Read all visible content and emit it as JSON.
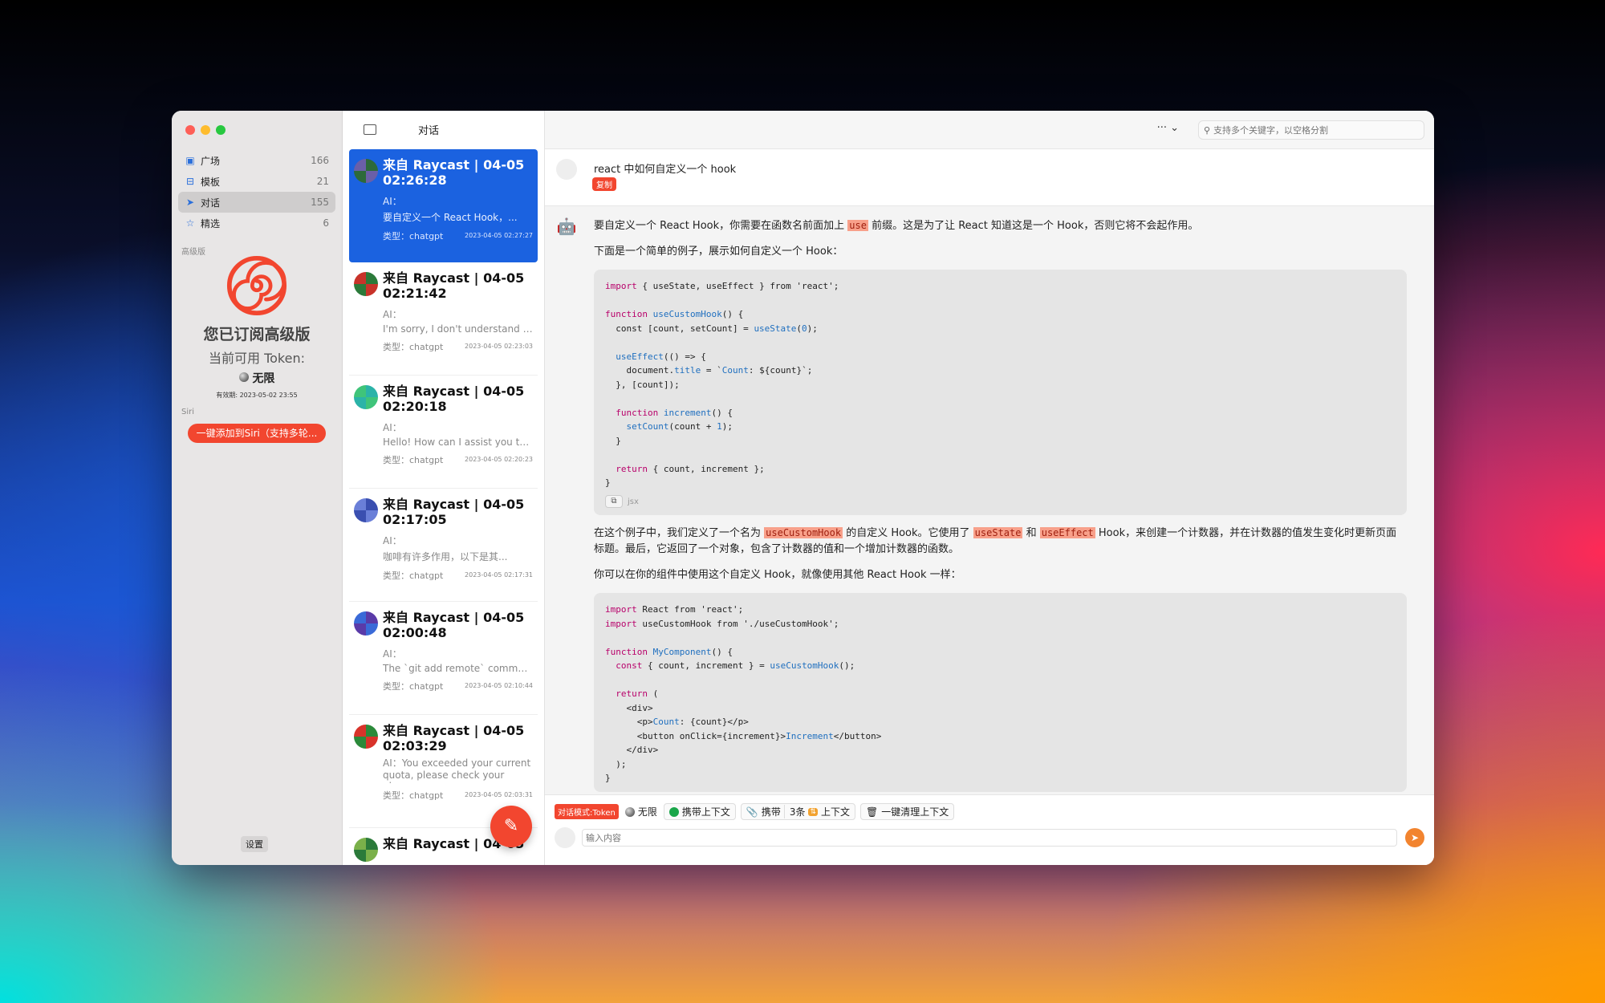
{
  "sidebar": {
    "items": [
      {
        "label": "广场",
        "count": "166"
      },
      {
        "label": "模板",
        "count": "21"
      },
      {
        "label": "对话",
        "count": "155"
      },
      {
        "label": "精选",
        "count": "6"
      }
    ],
    "premium_section": "高级版",
    "premium_title": "您已订阅高级版",
    "premium_token_label": "当前可用 Token:",
    "premium_token_value": "无限",
    "premium_expiry": "有效期: 2023-05-02 23:55",
    "siri_section": "Siri",
    "siri_button": "一键添加到Siri（支持多轮...",
    "settings_button": "设置"
  },
  "conversations": [
    {
      "title": "来自 Raycast | 04-05 02:26:28",
      "ai_label": "AI：",
      "preview": "要自定义一个 React Hook，...",
      "type_label": "类型：",
      "type": "chatgpt",
      "datetime": "2023-04-05 02:27:27"
    },
    {
      "title": "来自 Raycast | 04-05 02:21:42",
      "ai_label": "AI：",
      "preview": "I'm sorry, I don't understand w...",
      "type_label": "类型：",
      "type": "chatgpt",
      "datetime": "2023-04-05 02:23:03"
    },
    {
      "title": "来自 Raycast | 04-05 02:20:18",
      "ai_label": "AI：",
      "preview": "Hello! How can I assist you to...",
      "type_label": "类型：",
      "type": "chatgpt",
      "datetime": "2023-04-05 02:20:23"
    },
    {
      "title": "来自 Raycast | 04-05 02:17:05",
      "ai_label": "AI：",
      "preview": "咖啡有许多作用，以下是其...",
      "type_label": "类型：",
      "type": "chatgpt",
      "datetime": "2023-04-05 02:17:31"
    },
    {
      "title": "来自 Raycast | 04-05 02:00:48",
      "ai_label": "AI：",
      "preview": "The `git add remote` comma...",
      "type_label": "类型：",
      "type": "chatgpt",
      "datetime": "2023-04-05 02:10:44"
    },
    {
      "title": "来自 Raycast | 04-05 02:03:29",
      "ai_label": "AI：",
      "preview": "You exceeded your current quota, please check your plan...",
      "type_label": "类型：",
      "type": "chatgpt",
      "datetime": "2023-04-05 02:03:31"
    },
    {
      "title": "来自 Raycast | 04-05",
      "ai_label": "",
      "preview": "",
      "type_label": "",
      "type": "",
      "datetime": ""
    }
  ],
  "topbar": {
    "title": "对话",
    "more": "··· ⌄",
    "search_placeholder": "支持多个关键字，以空格分割"
  },
  "question": {
    "text": "react 中如何自定义一个 hook",
    "copy_label": "复制"
  },
  "answer": {
    "p1_a": "要自定义一个 React Hook，你需要在函数名前面加上 ",
    "p1_hl": "use",
    "p1_b": " 前缀。这是为了让 React 知道这是一个 Hook，否则它将不会起作用。",
    "p2": "下面是一个简单的例子，展示如何自定义一个 Hook：",
    "code_lang": "jsx",
    "p3_a": "在这个例子中，我们定义了一个名为 ",
    "p3_hl1": "useCustomHook",
    "p3_b": " 的自定义 Hook。它使用了 ",
    "p3_hl2": "useState",
    "p3_c": " 和 ",
    "p3_hl3": "useEffect",
    "p3_d": " Hook，来创建一个计数器，并在计数器的值发生变化时更新页面标题。最后，它返回了一个对象，包含了计数器的值和一个增加计数器的函数。",
    "p4": "你可以在你的组件中使用这个自定义 Hook，就像使用其他 React Hook 一样："
  },
  "bottom": {
    "mode": "对话模式:Token",
    "token": "无限",
    "with_context": "携带上下文",
    "carry": "携带",
    "count": "3条",
    "context": "上下文",
    "clear": "一键清理上下文",
    "input_placeholder": "输入内容"
  },
  "colors": {
    "accent": "#f2462f",
    "selected": "#1b62e0"
  }
}
